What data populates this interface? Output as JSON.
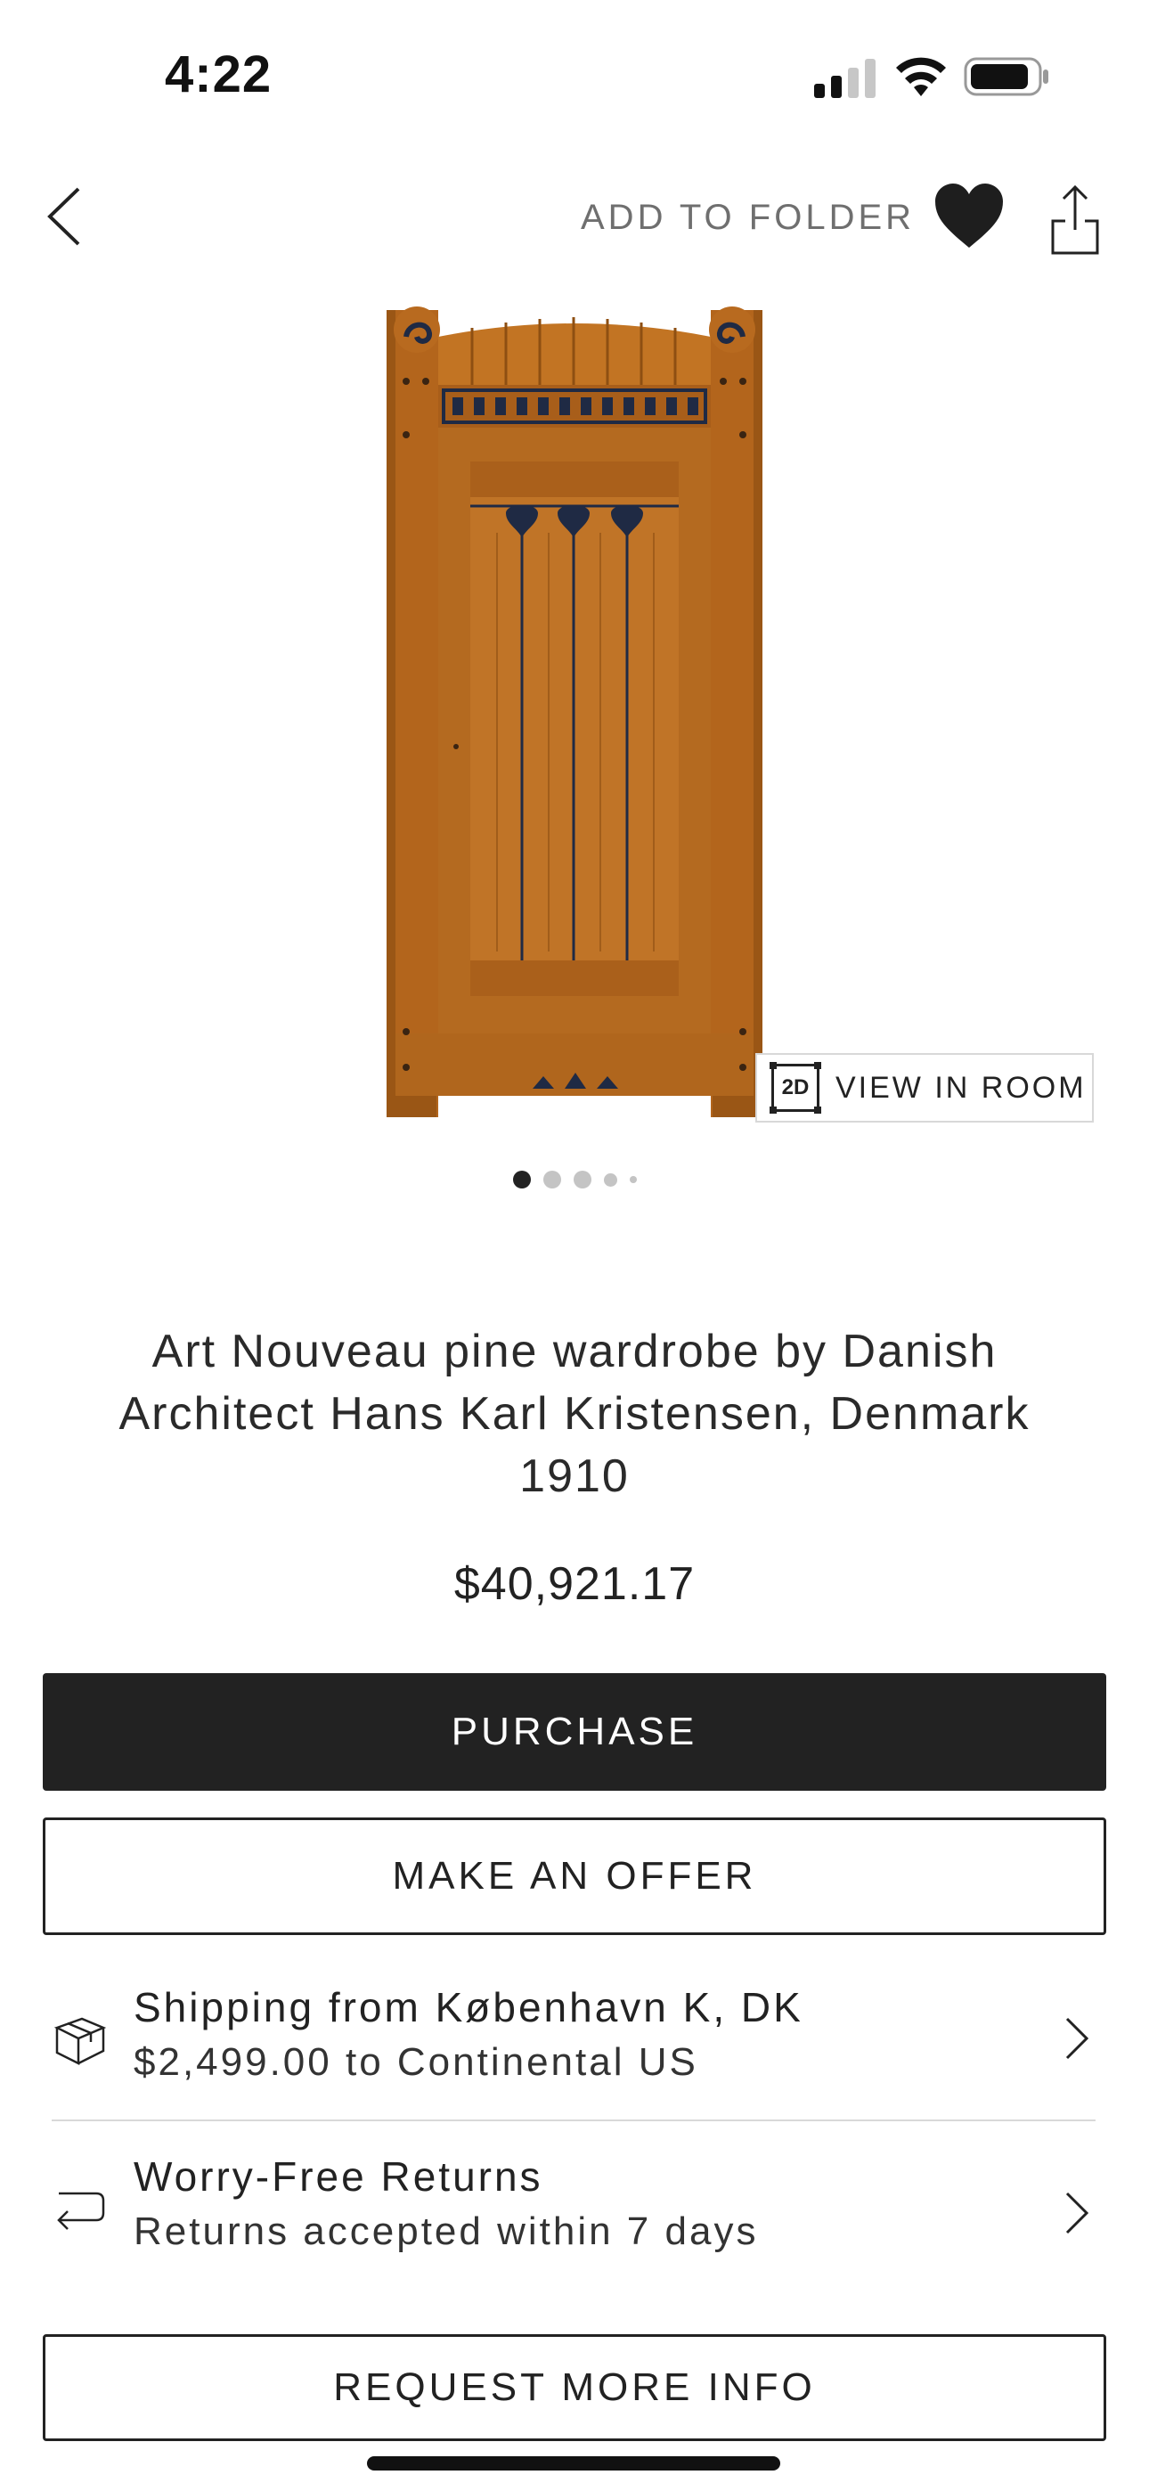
{
  "status_bar": {
    "time": "4:22",
    "icons": [
      "signal-icon",
      "wifi-icon",
      "battery-icon"
    ]
  },
  "nav": {
    "back_icon": "chevron-left-icon",
    "add_to_folder": "ADD TO FOLDER",
    "favorite_icon": "heart-icon",
    "share_icon": "share-icon"
  },
  "product": {
    "image_alt_icon": "wardrobe-image",
    "view_in_room_badge": "2D",
    "view_in_room": "VIEW IN ROOM",
    "carousel": {
      "total": 5,
      "active": 1
    },
    "title": "Art Nouveau pine wardrobe by Danish Architect Hans Karl Kristensen, Denmark 1910",
    "price": "$40,921.17"
  },
  "actions": {
    "purchase": "PURCHASE",
    "make_offer": "MAKE AN OFFER",
    "request_info": "REQUEST MORE INFO"
  },
  "shipping": {
    "icon": "box-icon",
    "line1": "Shipping from København K, DK",
    "line2": "$2,499.00 to Continental US"
  },
  "returns": {
    "icon": "return-arrow-icon",
    "line1": "Worry-Free Returns",
    "line2": "Returns accepted within 7 days"
  },
  "colors": {
    "primary_button": "#222222",
    "wood": "#b86a1f",
    "inlay": "#1f2a44"
  }
}
